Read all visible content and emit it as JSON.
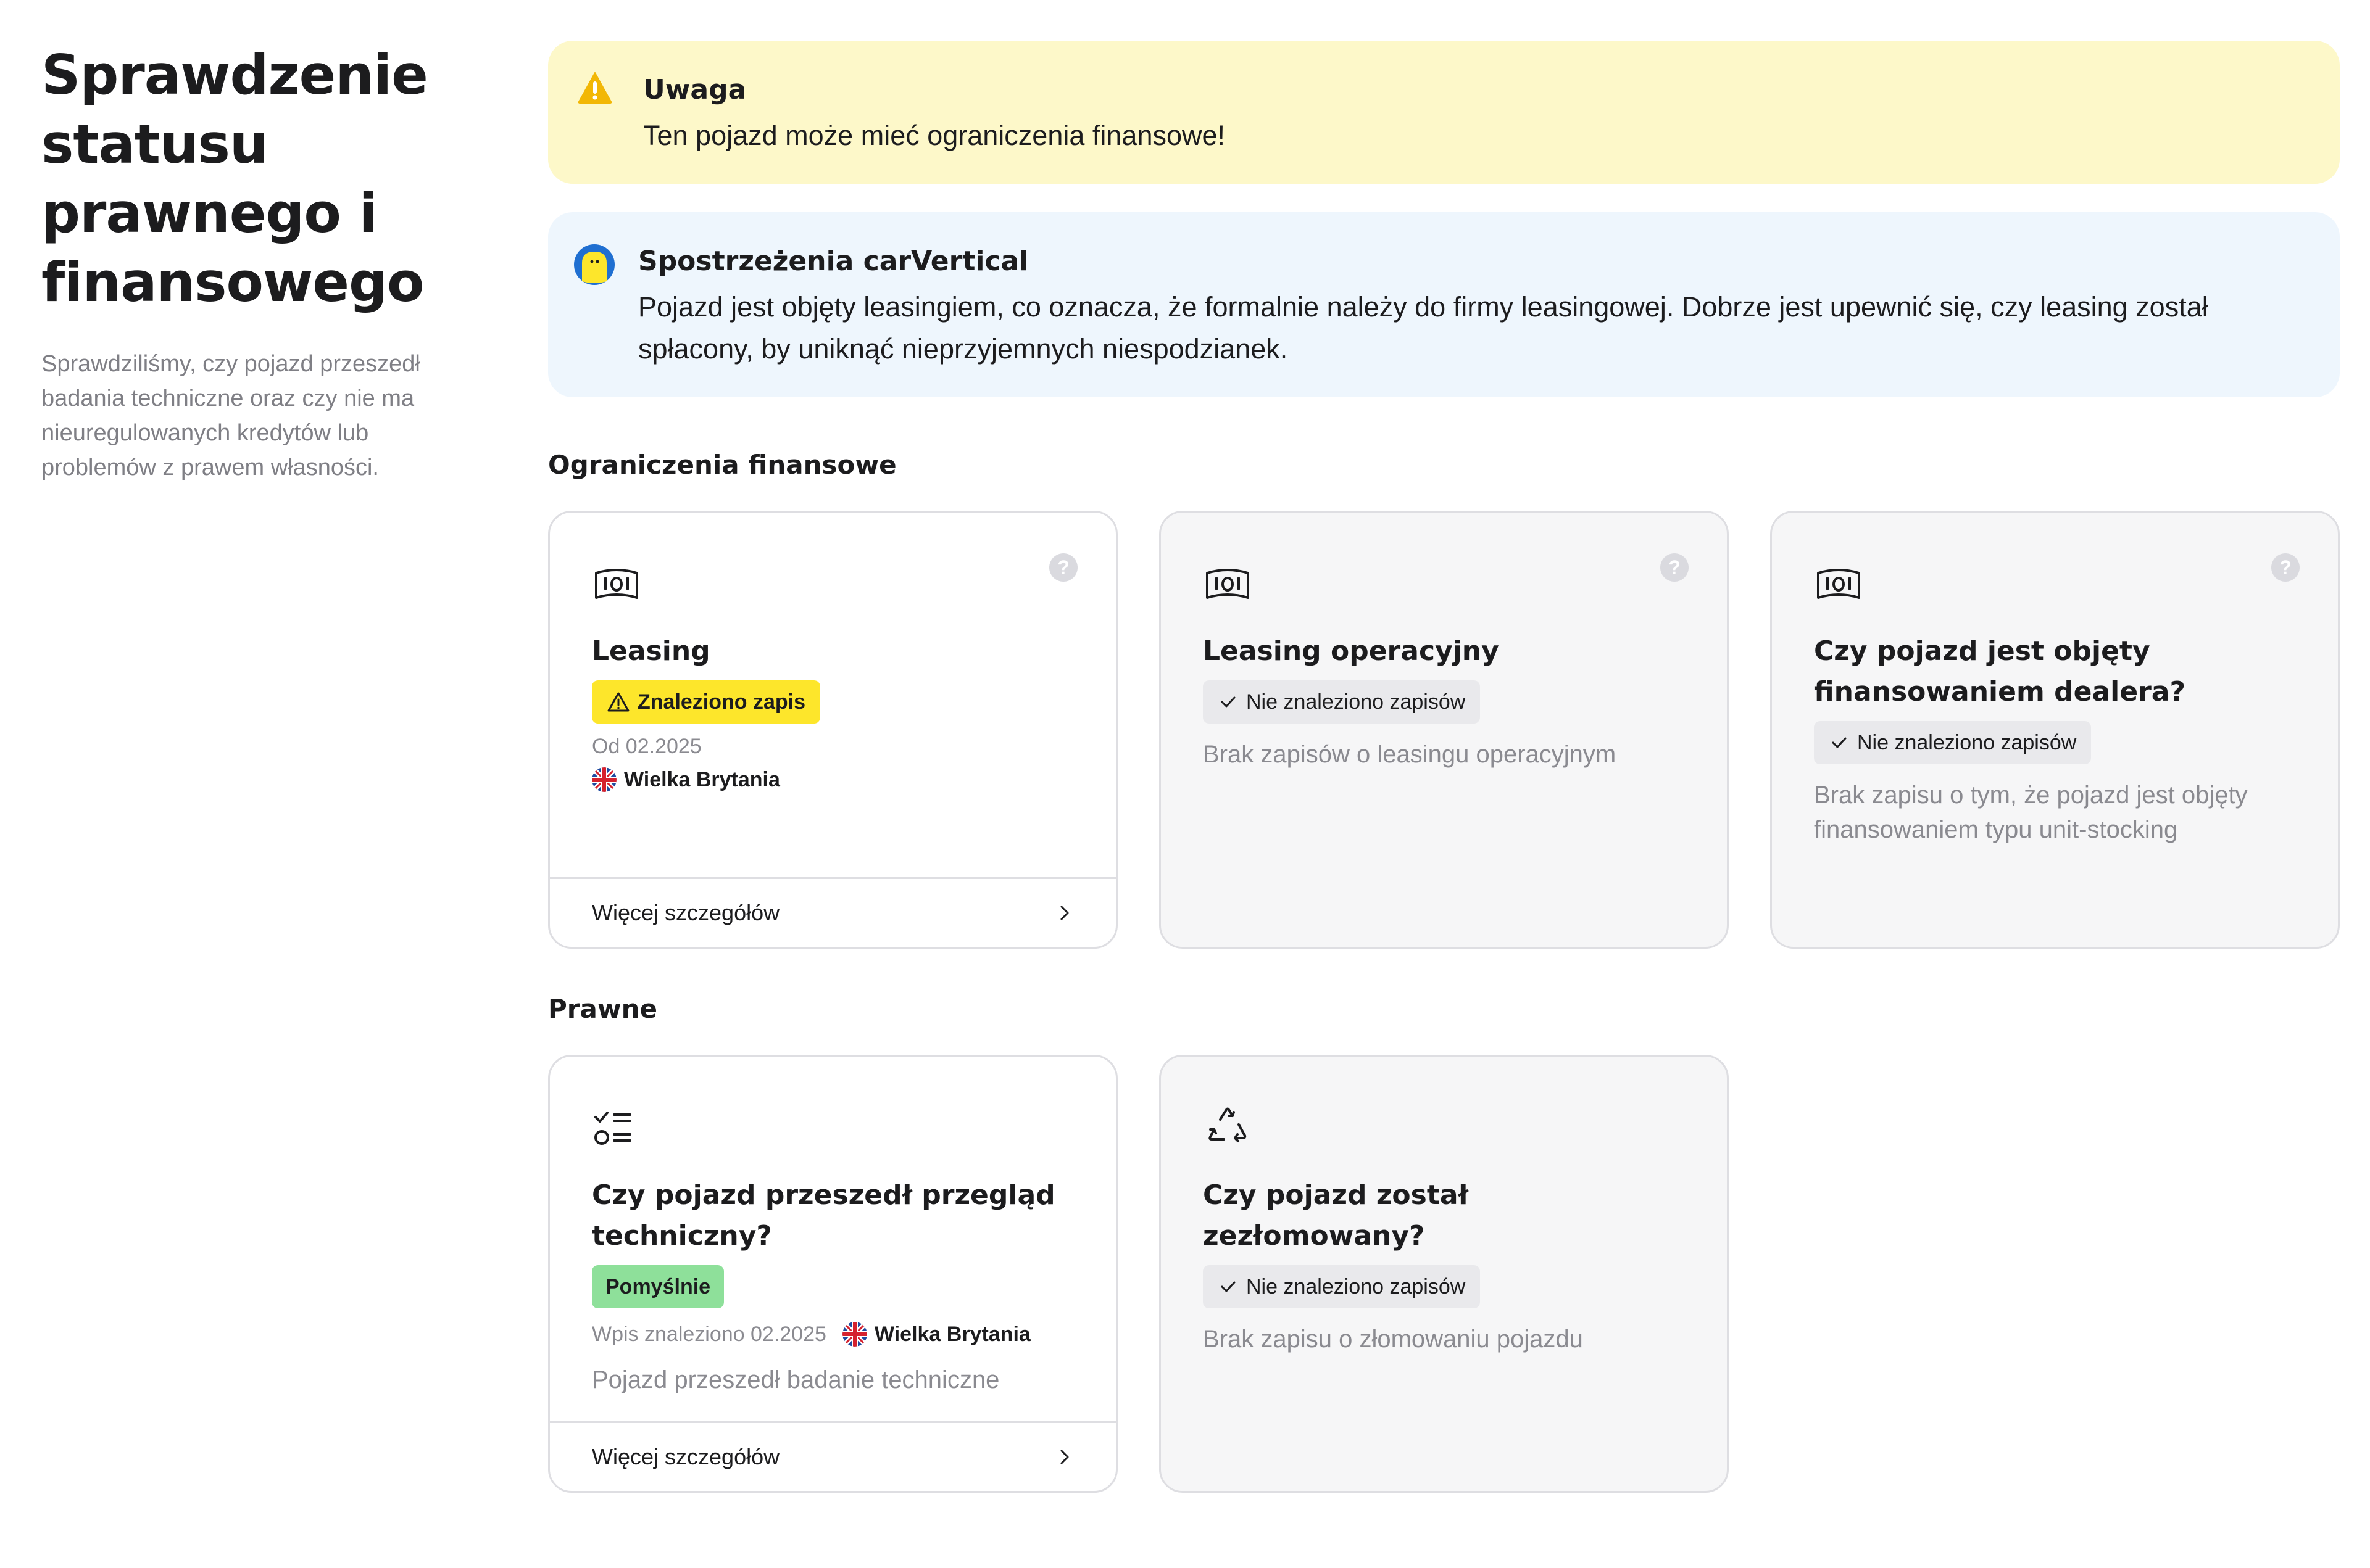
{
  "sidebar": {
    "title": "Sprawdzenie statusu prawnego i finansowego",
    "description": "Sprawdziliśmy, czy pojazd przeszedł badania techniczne oraz czy nie ma nieuregulowanych kredytów lub problemów z prawem własności."
  },
  "warning": {
    "icon": "warning-triangle-icon",
    "title": "Uwaga",
    "text": "Ten pojazd może mieć ograniczenia finansowe!"
  },
  "insight": {
    "icon": "carvertical-logo-icon",
    "title": "Spostrzeżenia carVertical",
    "text": "Pojazd jest objęty leasingiem, co oznacza, że formalnie należy do firmy leasingowej. Dobrze jest upewnić się, czy leasing został spłacony, by uniknąć nieprzyjemnych niespodzianek."
  },
  "financial": {
    "title": "Ograniczenia finansowe",
    "cards": [
      {
        "icon": "banknote-icon",
        "title": "Leasing",
        "badge": "Znaleziono zapis",
        "date": "Od 02.2025",
        "country": "Wielka Brytania",
        "footer": "Więcej szczegółów"
      },
      {
        "icon": "banknote-icon",
        "title": "Leasing operacyjny",
        "badge": "Nie znaleziono zapisów",
        "description": "Brak zapisów o leasingu operacyjnym"
      },
      {
        "icon": "banknote-icon",
        "title": "Czy pojazd jest objęty finansowaniem dealera?",
        "badge": "Nie znaleziono zapisów",
        "description": "Brak zapisu o tym, że pojazd jest objęty finansowaniem typu unit-stocking"
      }
    ]
  },
  "legal": {
    "title": "Prawne",
    "cards": [
      {
        "icon": "checklist-icon",
        "title": "Czy pojazd przeszedł przegląd techniczny?",
        "badge": "Pomyślnie",
        "date": "Wpis znaleziono 02.2025",
        "country": "Wielka Brytania",
        "description": "Pojazd przeszedł badanie techniczne",
        "footer": "Więcej szczegółów"
      },
      {
        "icon": "recycle-icon",
        "title": "Czy pojazd został zezłomowany?",
        "badge": "Nie znaleziono zapisów",
        "description": "Brak zapisu o złomowaniu pojazdu"
      }
    ]
  },
  "colors": {
    "warning_bg": "#fdf8c9",
    "insight_bg": "#eef6fd",
    "badge_found": "#fde62b",
    "badge_pass": "#8ee09a",
    "badge_none": "#e9e9ec"
  }
}
